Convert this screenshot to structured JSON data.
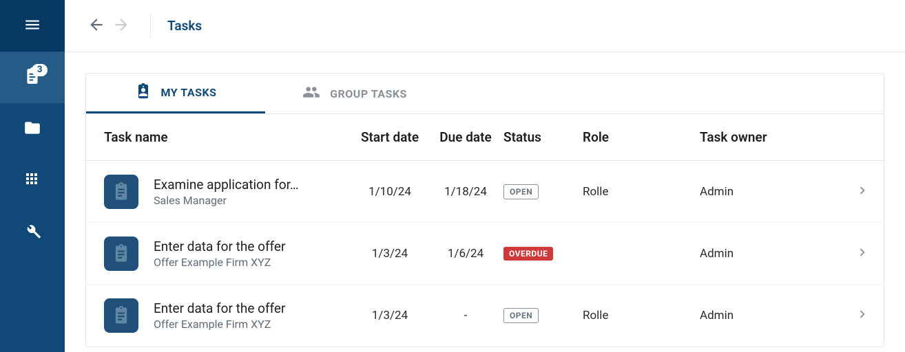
{
  "sidebar": {
    "badge": "3"
  },
  "header": {
    "title": "Tasks"
  },
  "tabs": {
    "my_tasks": "MY TASKS",
    "group_tasks": "GROUP TASKS"
  },
  "table": {
    "head": {
      "name": "Task name",
      "start": "Start date",
      "due": "Due date",
      "status": "Status",
      "role": "Role",
      "owner": "Task owner"
    },
    "rows": [
      {
        "title": "Examine application for…",
        "subtitle": "Sales Manager",
        "start": "1/10/24",
        "due": "1/18/24",
        "status_text": "OPEN",
        "status_kind": "open",
        "role": "Rolle",
        "owner": "Admin"
      },
      {
        "title": "Enter data for the offer",
        "subtitle": "Offer Example Firm XYZ",
        "start": "1/3/24",
        "due": "1/6/24",
        "status_text": "OVERDUE",
        "status_kind": "overdue",
        "role": "",
        "owner": "Admin"
      },
      {
        "title": "Enter data for the offer",
        "subtitle": "Offer Example Firm XYZ",
        "start": "1/3/24",
        "due": "-",
        "status_text": "OPEN",
        "status_kind": "open",
        "role": "Rolle",
        "owner": "Admin"
      }
    ]
  }
}
